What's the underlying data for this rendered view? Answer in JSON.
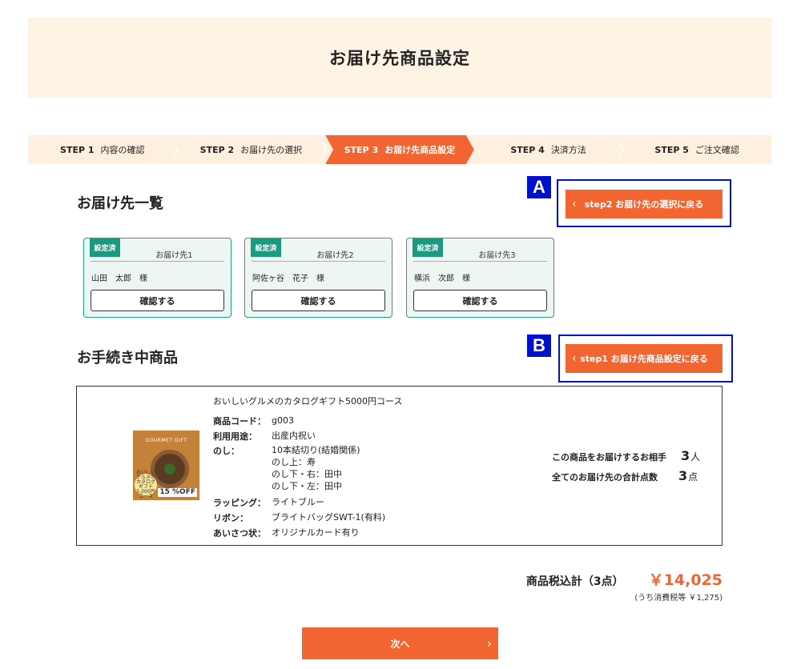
{
  "page_title": "お届け先商品設定",
  "steps": [
    {
      "num": "STEP 1",
      "label": "内容の確認"
    },
    {
      "num": "STEP 2",
      "label": "お届け先の選択"
    },
    {
      "num": "STEP 3",
      "label": "お届け先商品設定"
    },
    {
      "num": "STEP 4",
      "label": "決済方法"
    },
    {
      "num": "STEP 5",
      "label": "ご注文確認"
    }
  ],
  "active_step": 3,
  "destinations_section": {
    "title": "お届け先一覧",
    "annotation": "A",
    "back_button": "step2 お届け先の選択に戻る",
    "cards": [
      {
        "tag": "設定済",
        "caption": "お届け先1",
        "name": "山田　太郎　様",
        "button": "確認する"
      },
      {
        "tag": "設定済",
        "caption": "お届け先2",
        "name": "阿佐ヶ谷　花子　様",
        "button": "確認する"
      },
      {
        "tag": "設定済",
        "caption": "お届け先3",
        "name": "横浜　次郎　様",
        "button": "確認する"
      }
    ]
  },
  "products_section": {
    "title": "お手続き中商品",
    "annotation": "B",
    "back_button": "step1 お届け先商品設定に戻る"
  },
  "product": {
    "name": "おいしいグルメのカタログギフト5000円コース",
    "image": {
      "title": "GOURMET GIFT",
      "seal": "おいしいグルメの カタログギフト 5,000円 コース",
      "badge": "15 %OFF"
    },
    "specs": [
      {
        "key": "商品コード：",
        "lines": [
          "g003"
        ]
      },
      {
        "key": "利用用途：",
        "lines": [
          "出産内祝い"
        ]
      },
      {
        "key": "のし：",
        "lines": [
          "10本結切り(結婚関係)",
          "のし上：寿",
          "のし下・右：田中",
          "のし下・左：田中"
        ]
      },
      {
        "key": "ラッピング：",
        "lines": [
          "ライトブルー"
        ]
      },
      {
        "key": "リボン：",
        "lines": [
          "ブライトバッグSWT-1(有料)"
        ]
      },
      {
        "key": "あいさつ状：",
        "lines": [
          "オリジナルカード有り"
        ]
      }
    ],
    "recipients_label": "この商品をお届けするお相手",
    "recipients_count": "3",
    "recipients_unit": "人",
    "total_items_label": "全てのお届け先の合計点数",
    "total_items_count": "3",
    "total_items_unit": "点"
  },
  "summary": {
    "label": "商品税込計（3点）",
    "value": "￥14,025",
    "tax_note": "(うち消費税等 ￥1,275)"
  },
  "next_button": "次へ",
  "colors": {
    "accent": "#f26531",
    "teal": "#1b9a80",
    "annotation_blue": "#0011cc",
    "header_bg": "#fdf4e6"
  }
}
